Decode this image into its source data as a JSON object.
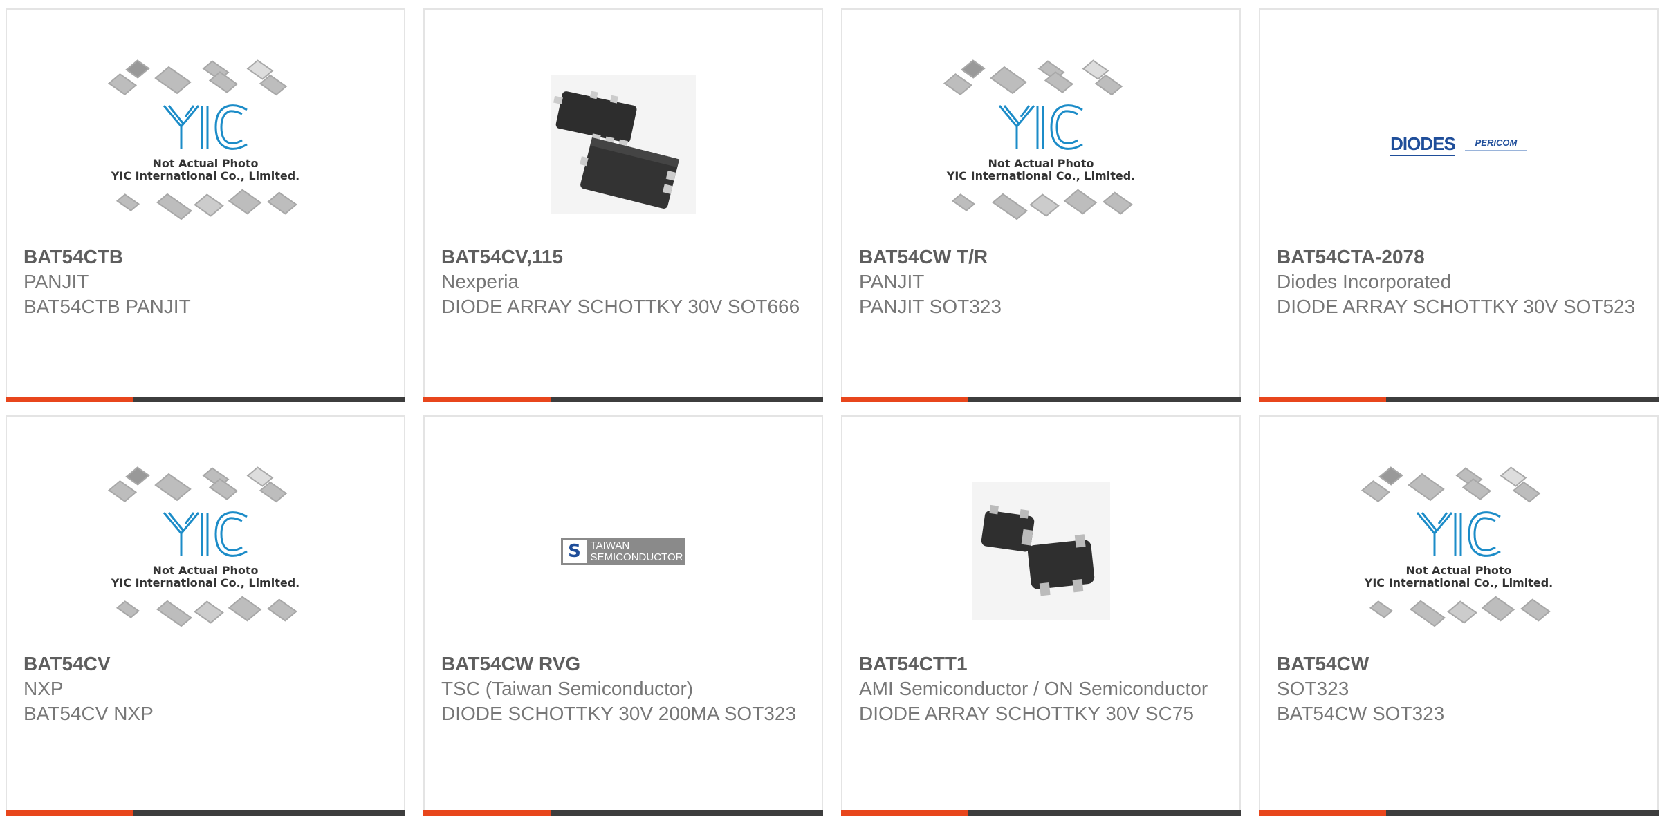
{
  "colors": {
    "accent": "#e8461c",
    "bar": "#3d3d3d",
    "border": "#e4e4e4",
    "text": "#777777"
  },
  "placeholder": {
    "line1": "Not Actual Photo",
    "line2": "YIC International Co., Limited."
  },
  "logos": {
    "diodes": "DIODES",
    "pericom": "PERICOM",
    "tsc_line1": "TAIWAN",
    "tsc_line2": "SEMICONDUCTOR"
  },
  "products": [
    {
      "part": "BAT54CTB",
      "maker": "PANJIT",
      "desc": "BAT54CTB PANJIT",
      "image": "yic-placeholder"
    },
    {
      "part": "BAT54CV,115",
      "maker": "Nexperia",
      "desc": "DIODE ARRAY SCHOTTKY 30V SOT666",
      "image": "sot666-package"
    },
    {
      "part": "BAT54CW T/R",
      "maker": "PANJIT",
      "desc": "PANJIT SOT323",
      "image": "yic-placeholder"
    },
    {
      "part": "BAT54CTA-2078",
      "maker": "Diodes Incorporated",
      "desc": "DIODE ARRAY SCHOTTKY 30V SOT523",
      "image": "diodes-logo"
    },
    {
      "part": "BAT54CV",
      "maker": "NXP",
      "desc": "BAT54CV NXP",
      "image": "yic-placeholder"
    },
    {
      "part": "BAT54CW RVG",
      "maker": "TSC (Taiwan Semiconductor)",
      "desc": "DIODE SCHOTTKY 30V 200MA SOT323",
      "image": "tsc-logo"
    },
    {
      "part": "BAT54CTT1",
      "maker": "AMI Semiconductor / ON Semiconductor",
      "desc": "DIODE ARRAY SCHOTTKY 30V SC75",
      "image": "sc75-package"
    },
    {
      "part": "BAT54CW",
      "maker": "SOT323",
      "desc": "BAT54CW SOT323",
      "image": "yic-placeholder"
    }
  ]
}
